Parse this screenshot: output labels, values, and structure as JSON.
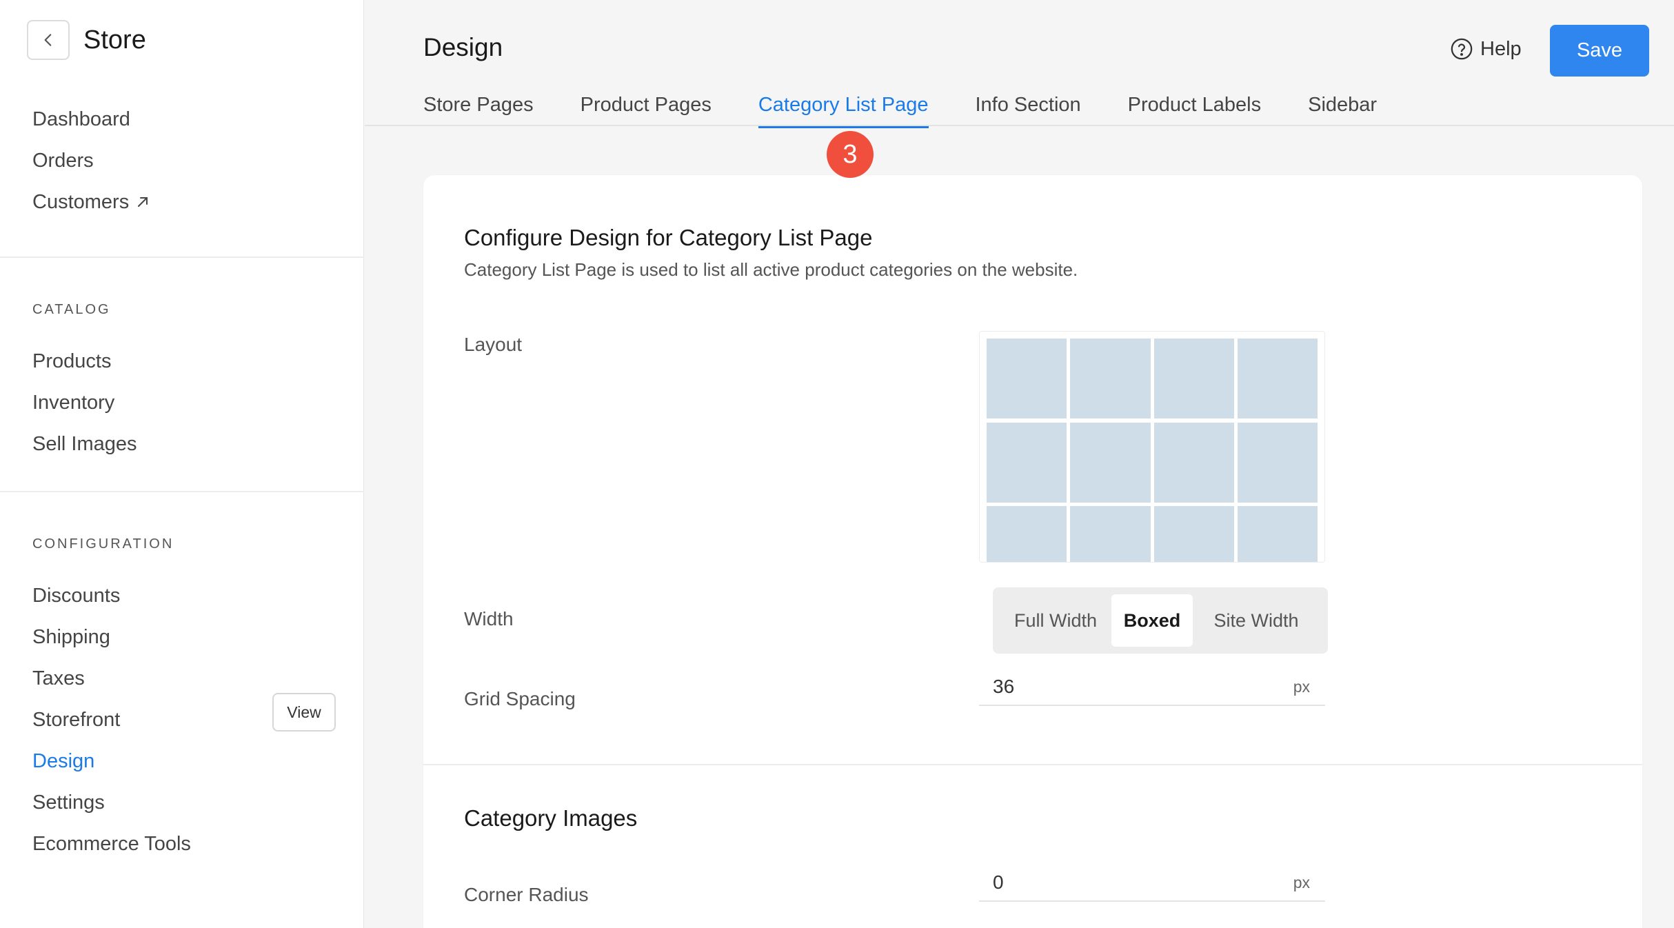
{
  "sidebar": {
    "title": "Store",
    "top_items": [
      {
        "label": "Dashboard"
      },
      {
        "label": "Orders"
      },
      {
        "label": "Customers"
      }
    ],
    "catalog": {
      "section_label": "CATALOG",
      "items": [
        {
          "label": "Products"
        },
        {
          "label": "Inventory"
        },
        {
          "label": "Sell Images"
        }
      ]
    },
    "configuration": {
      "section_label": "CONFIGURATION",
      "items": [
        {
          "label": "Discounts"
        },
        {
          "label": "Shipping"
        },
        {
          "label": "Taxes"
        },
        {
          "label": "Storefront"
        },
        {
          "label": "Design"
        },
        {
          "label": "Settings"
        },
        {
          "label": "Ecommerce Tools"
        }
      ],
      "storefront_view_label": "View",
      "active_item": "Design"
    }
  },
  "header": {
    "title": "Design",
    "help_label": "Help",
    "save_label": "Save",
    "tabs": [
      {
        "label": "Store Pages"
      },
      {
        "label": "Product Pages"
      },
      {
        "label": "Category List Page"
      },
      {
        "label": "Info Section"
      },
      {
        "label": "Product Labels"
      },
      {
        "label": "Sidebar"
      }
    ],
    "active_tab": "Category List Page"
  },
  "step_badge": "3",
  "card": {
    "title": "Configure Design for Category List Page",
    "description": "Category List Page is used to list all active product categories on the website.",
    "layout_label": "Layout",
    "width": {
      "label": "Width",
      "options": [
        "Full Width",
        "Boxed",
        "Site Width"
      ],
      "selected": "Boxed"
    },
    "grid_spacing": {
      "label": "Grid Spacing",
      "value": "36",
      "unit": "px"
    },
    "category_images": {
      "title": "Category Images",
      "corner_radius": {
        "label": "Corner Radius",
        "value": "0",
        "unit": "px"
      }
    }
  },
  "colors": {
    "accent": "#1a7be8",
    "save_button": "#2f86ef",
    "badge": "#f04f3d",
    "layout_cell": "#cfdde8"
  }
}
